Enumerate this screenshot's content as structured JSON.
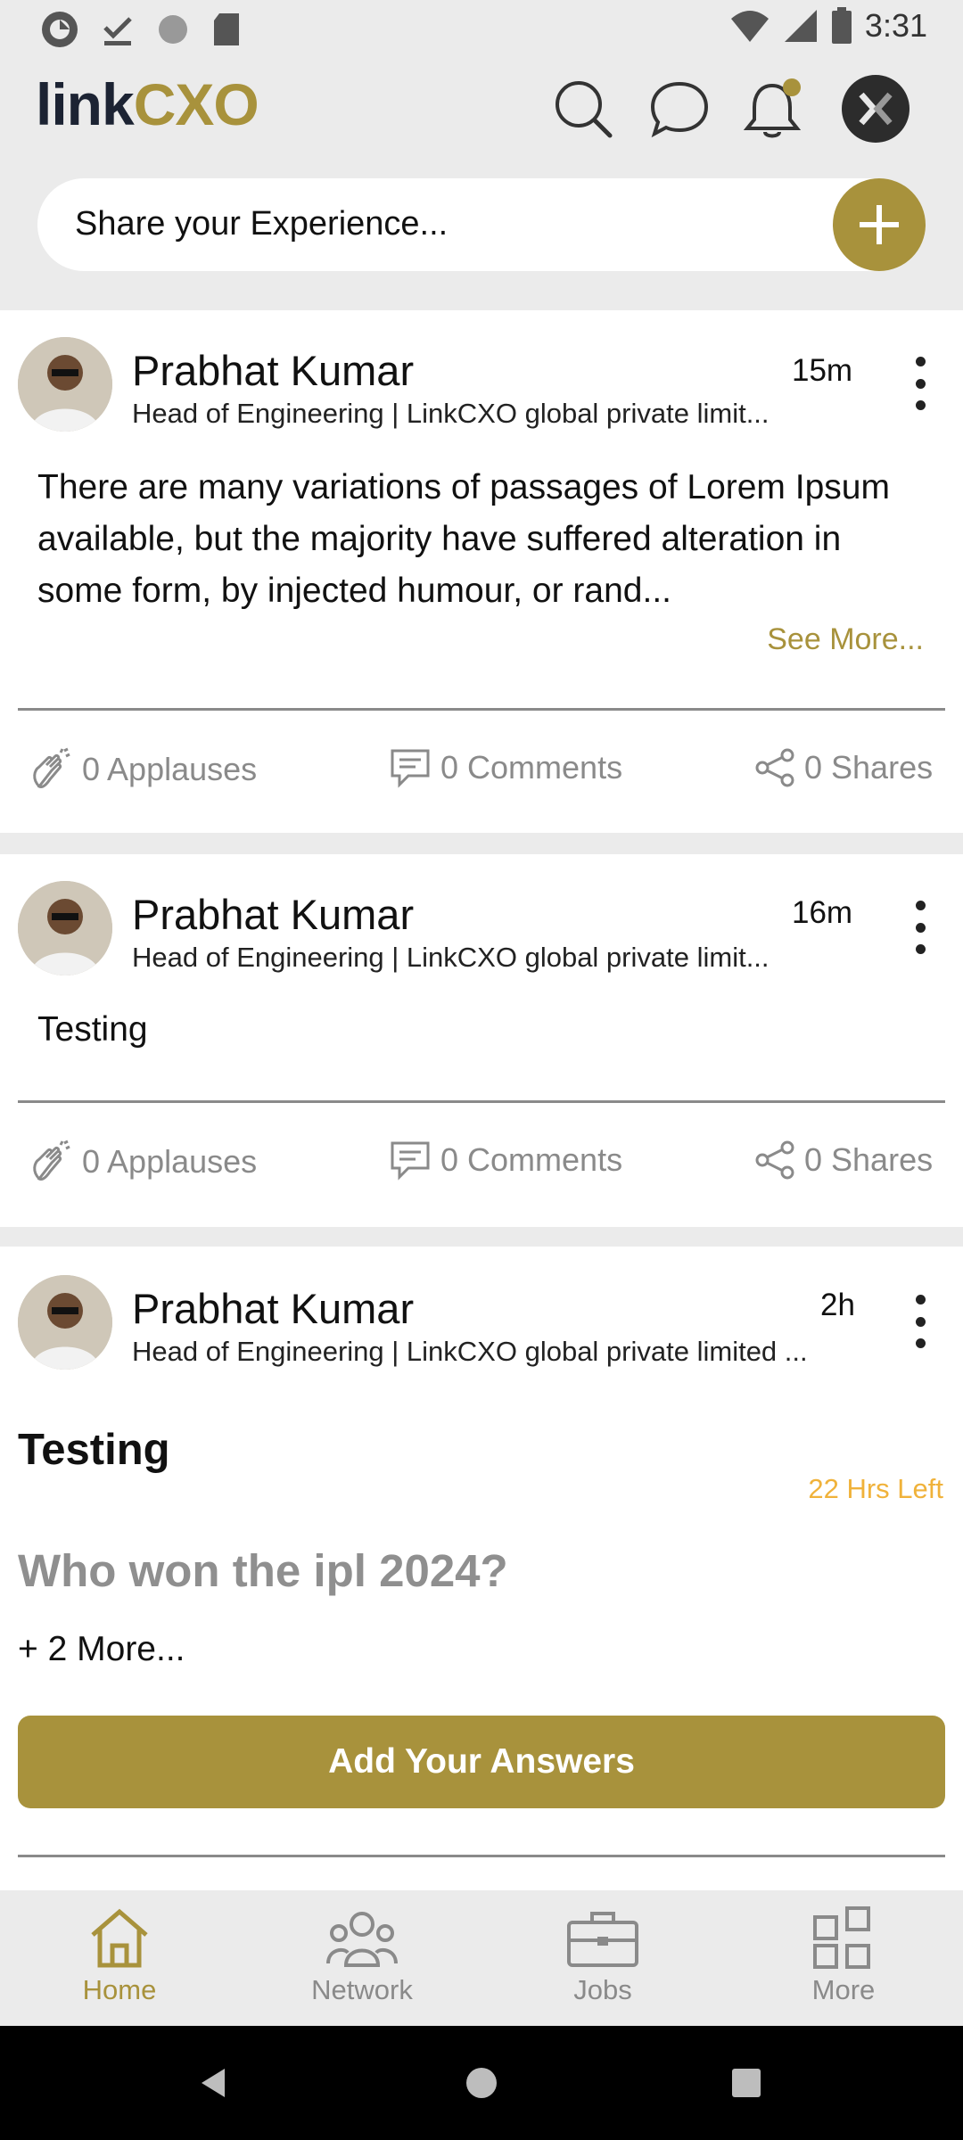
{
  "status_bar": {
    "time": "3:31",
    "left_icons": [
      "sync-icon",
      "download-done-icon",
      "circle-icon",
      "sd-card-icon"
    ],
    "right_icons": [
      "wifi-icon",
      "signal-icon",
      "battery-icon"
    ]
  },
  "header": {
    "logo": {
      "part1": "link",
      "part2": "CXO"
    },
    "icons": [
      "search-icon",
      "chat-icon",
      "bell-icon",
      "profile-icon"
    ],
    "share_placeholder": "Share your Experience...",
    "accent": "#a8923c"
  },
  "posts": [
    {
      "author": "Prabhat Kumar",
      "title": "Head of Engineering | LinkCXO global private limit...",
      "time": "15m",
      "body": "There are many variations of passages of Lorem Ipsum available, but the majority have suffered alteration in some form, by injected humour, or rand...",
      "see_more": "See More...",
      "applauses": "0 Applauses",
      "comments": "0 Comments",
      "shares": "0 Shares"
    },
    {
      "author": "Prabhat Kumar",
      "title": "Head of Engineering | LinkCXO global private limit...",
      "time": "16m",
      "body": "Testing",
      "applauses": "0 Applauses",
      "comments": "0 Comments",
      "shares": "0 Shares"
    },
    {
      "author": "Prabhat Kumar",
      "title": "Head of Engineering | LinkCXO global private limited ...",
      "time": "2h",
      "poll_title": "Testing",
      "time_left": "22 Hrs Left",
      "question": "Who won the ipl 2024?",
      "more": "+ 2 More...",
      "answer_button": "Add Your Answers"
    }
  ],
  "bottom_nav": [
    {
      "label": "Home",
      "icon": "home-icon",
      "active": true
    },
    {
      "label": "Network",
      "icon": "network-icon",
      "active": false
    },
    {
      "label": "Jobs",
      "icon": "briefcase-icon",
      "active": false
    },
    {
      "label": "More",
      "icon": "grid-icon",
      "active": false
    }
  ],
  "system_nav": [
    "back-icon",
    "home-circle-icon",
    "recents-icon"
  ]
}
